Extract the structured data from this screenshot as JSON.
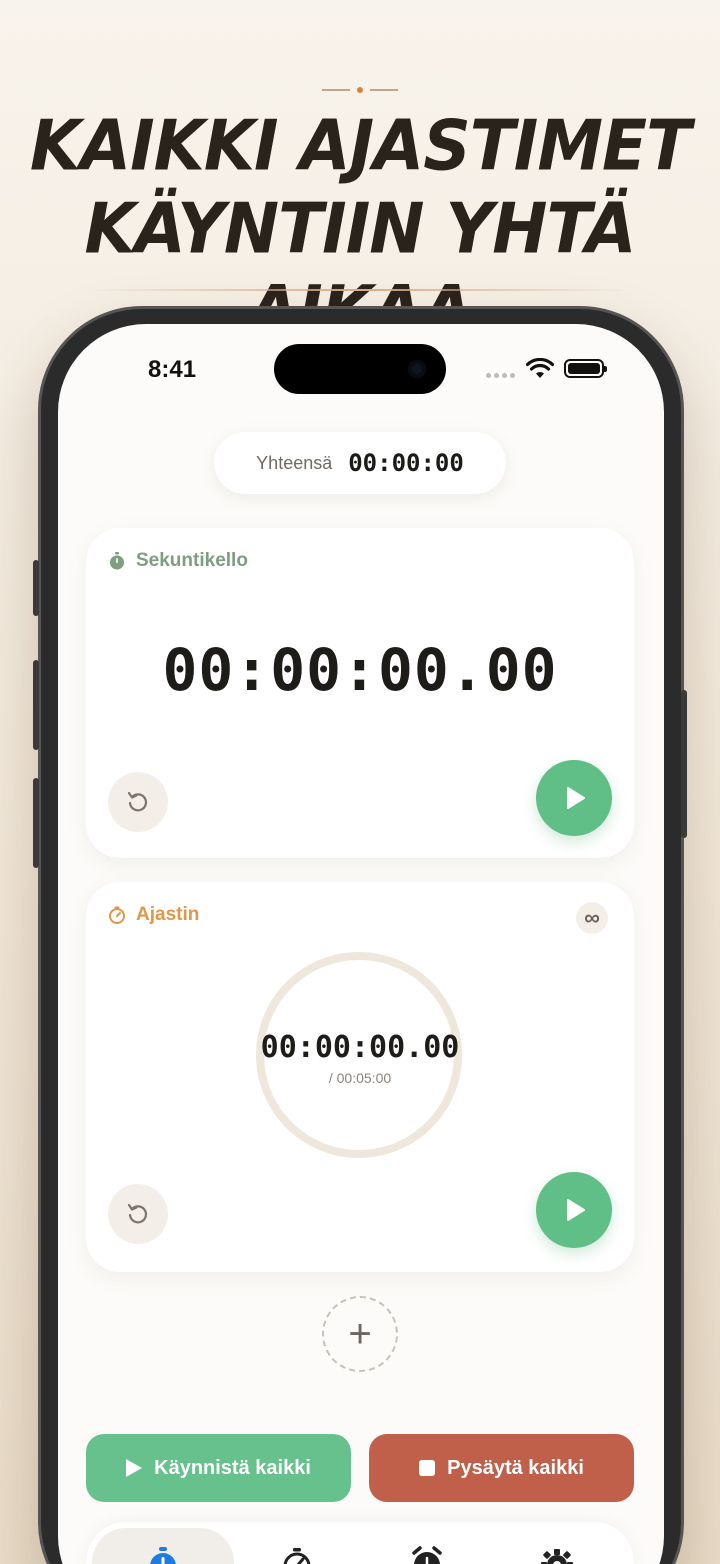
{
  "headline": {
    "line1": "KAIKKI AJASTIMET",
    "line2": "KÄYNTIIN YHTÄ AIKAA"
  },
  "status_bar": {
    "time": "8:41"
  },
  "total": {
    "label": "Yhteensä",
    "value": "00:00:00"
  },
  "stopwatch_card": {
    "title": "Sekuntikello",
    "time": "00:00:00.00",
    "icon": "stopwatch-icon",
    "accent": "#7d9e80"
  },
  "timer_card": {
    "title": "Ajastin",
    "time": "00:00:00.00",
    "total": "/ 00:05:00",
    "loop_symbol": "∞",
    "icon": "timer-icon",
    "accent": "#e09748"
  },
  "add_button": {
    "symbol": "+"
  },
  "actions": {
    "start_all": "Käynnistä kaikki",
    "stop_all": "Pysäytä kaikki",
    "start_color": "#66c18c",
    "stop_color": "#c0604a"
  },
  "tabs": [
    {
      "icon": "stopwatch-icon",
      "active": true
    },
    {
      "icon": "timer-icon",
      "active": false
    },
    {
      "icon": "alarm-clock-icon",
      "active": false
    },
    {
      "icon": "gear-icon",
      "active": false
    }
  ],
  "colors": {
    "play_green": "#5fbf86",
    "active_tab_blue": "#1e7be0"
  }
}
